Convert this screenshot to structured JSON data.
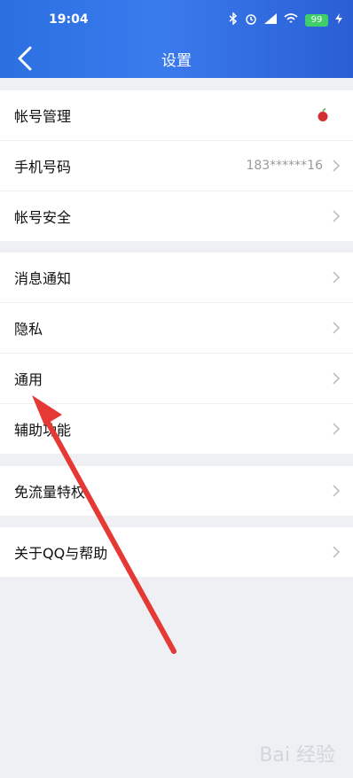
{
  "status_bar": {
    "time": "19:04",
    "battery": "99"
  },
  "header": {
    "title": "设置"
  },
  "groups": [
    {
      "items": [
        {
          "label": "帐号管理"
        },
        {
          "label": "手机号码",
          "value": "183******16"
        },
        {
          "label": "帐号安全"
        }
      ]
    },
    {
      "items": [
        {
          "label": "消息通知"
        },
        {
          "label": "隐私"
        },
        {
          "label": "通用"
        },
        {
          "label": "辅助功能"
        }
      ]
    },
    {
      "items": [
        {
          "label": "免流量特权"
        }
      ]
    },
    {
      "items": [
        {
          "label": "关于QQ与帮助"
        }
      ]
    }
  ],
  "watermark": {
    "text": "Bai 经验"
  },
  "colors": {
    "accent": "#2a6fe0",
    "annotation": "#e53935"
  }
}
